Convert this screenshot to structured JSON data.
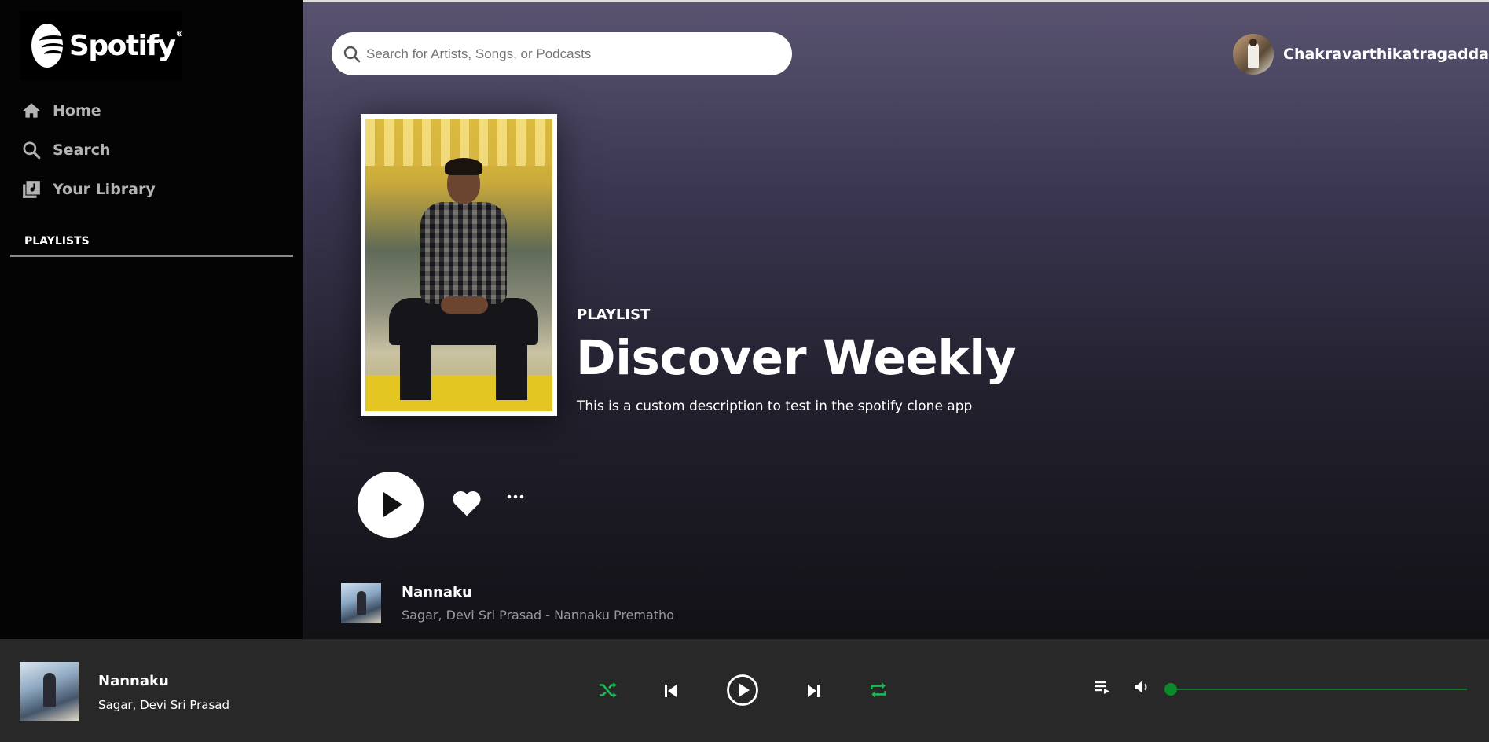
{
  "app": {
    "brand": "Spotify",
    "accent_color": "#1db954"
  },
  "sidebar": {
    "items": [
      {
        "label": "Home",
        "icon": "home-icon"
      },
      {
        "label": "Search",
        "icon": "search-icon"
      },
      {
        "label": "Your Library",
        "icon": "library-icon"
      }
    ],
    "playlists_title": "PLAYLISTS"
  },
  "header": {
    "search_placeholder": "Search for Artists, Songs, or Podcasts",
    "search_value": "",
    "user_name": "Chakravarthikatragadda"
  },
  "playlist": {
    "label": "PLAYLIST",
    "title": "Discover Weekly",
    "description": "This is a custom description to test in the spotify clone app"
  },
  "tracks": [
    {
      "title": "Nannaku",
      "subtitle": "Sagar, Devi Sri Prasad - Nannaku Prematho"
    }
  ],
  "player": {
    "now_playing_title": "Nannaku",
    "now_playing_artist": "Sagar, Devi Sri Prasad",
    "shuffle_color": "#1db954",
    "repeat_color": "#1db954",
    "volume_level": 0
  }
}
